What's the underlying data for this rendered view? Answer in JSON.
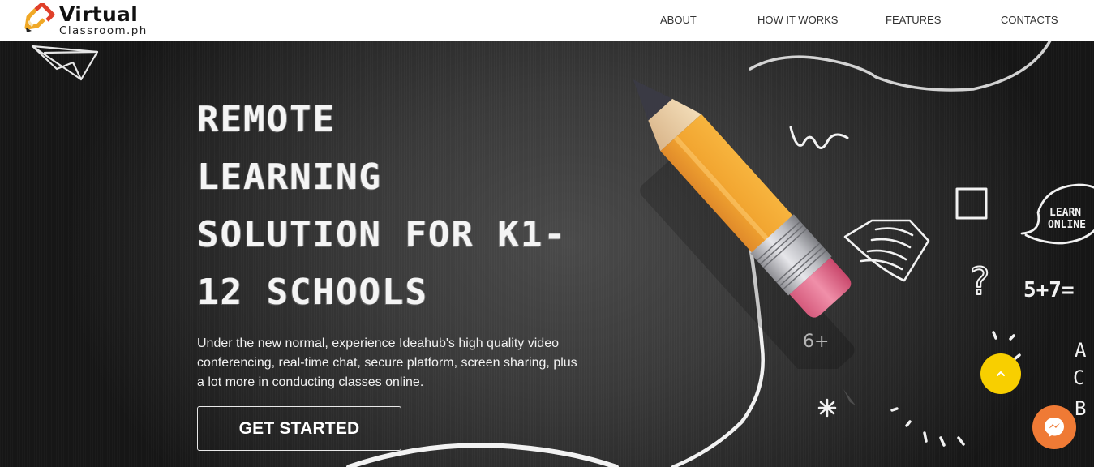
{
  "header": {
    "logo": {
      "brand": "Virtual",
      "sub": "Classroom.ph",
      "icon": "pencil-logo-icon",
      "colors": {
        "red": "#e0402a",
        "orange": "#f0a826"
      }
    },
    "nav": [
      {
        "label": "ABOUT"
      },
      {
        "label": "HOW IT WORKS"
      },
      {
        "label": "FEATURES"
      },
      {
        "label": "CONTACTS"
      }
    ]
  },
  "hero": {
    "headline_lines": [
      "REMOTE",
      "LEARNING",
      "SOLUTION FOR K1-",
      "12 SCHOOLS"
    ],
    "description": "Under the new normal, experience Ideahub's high quality video conferencing, real-time chat, secure platform, screen sharing, plus a lot more in conducting classes online.",
    "cta_label": "GET STARTED",
    "chalk_doodles": {
      "speech_bubble_text": [
        "LEARN",
        "ONLINE"
      ],
      "equation": "5+7=",
      "letters": [
        "A",
        "C",
        "B"
      ],
      "partial_number": "6+",
      "question_mark": "?"
    }
  },
  "floating": {
    "scroll_top_icon": "chevron-up-icon",
    "scroll_top_color": "#f8cf00",
    "messenger_icon": "messenger-icon",
    "messenger_color": "#ef7a35"
  }
}
